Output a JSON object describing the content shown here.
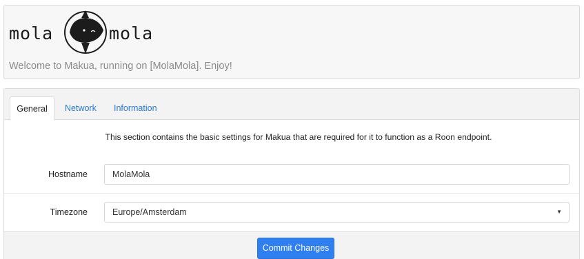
{
  "header": {
    "logo": {
      "left_text": "mola",
      "right_text": "mola",
      "icon": "sunfish-logo-icon"
    },
    "welcome": "Welcome to Makua, running on [MolaMola]. Enjoy!"
  },
  "tabs": [
    {
      "label": "General",
      "active": true
    },
    {
      "label": "Network",
      "active": false
    },
    {
      "label": "Information",
      "active": false
    }
  ],
  "general": {
    "description": "This section contains the basic settings for Makua that are required for it to function as a Roon endpoint.",
    "hostname": {
      "label": "Hostname",
      "value": "MolaMola"
    },
    "timezone": {
      "label": "Timezone",
      "value": "Europe/Amsterdam",
      "caret_icon": "caret-down-icon"
    },
    "commit_label": "Commit Changes"
  },
  "colors": {
    "link": "#2a7ad4",
    "primary_button": "#2f7ff0",
    "muted_text": "#8a8a8a"
  }
}
